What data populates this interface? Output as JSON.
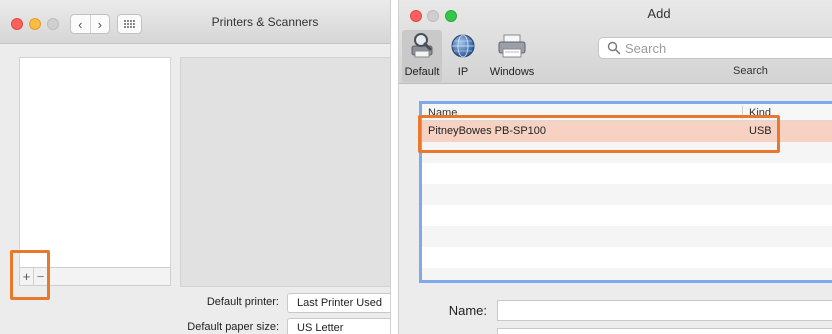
{
  "left_window": {
    "title": "Printers & Scanners",
    "nav": {
      "back": "‹",
      "forward": "›"
    },
    "toolbar": {
      "add": "+",
      "remove": "−"
    },
    "default_printer": {
      "label": "Default printer:",
      "value": "Last Printer Used"
    },
    "default_paper": {
      "label": "Default paper size:",
      "value": "US Letter"
    }
  },
  "right_window": {
    "title": "Add",
    "tabs": [
      {
        "label": "Default",
        "icon": "default-printer-icon"
      },
      {
        "label": "IP",
        "icon": "globe-icon"
      },
      {
        "label": "Windows",
        "icon": "windows-printer-icon"
      }
    ],
    "search": {
      "placeholder": "Search",
      "label": "Search"
    },
    "columns": {
      "name": "Name",
      "kind": "Kind"
    },
    "printers": [
      {
        "name": "PitneyBowes PB-SP100",
        "kind": "USB"
      }
    ],
    "form": {
      "name_label": "Name:"
    }
  },
  "colors": {
    "highlight": "#e8782c",
    "selection": "#7fa8ee",
    "close": "#fc605c",
    "minimize": "#fdbc40",
    "zoom": "#34c84a"
  }
}
